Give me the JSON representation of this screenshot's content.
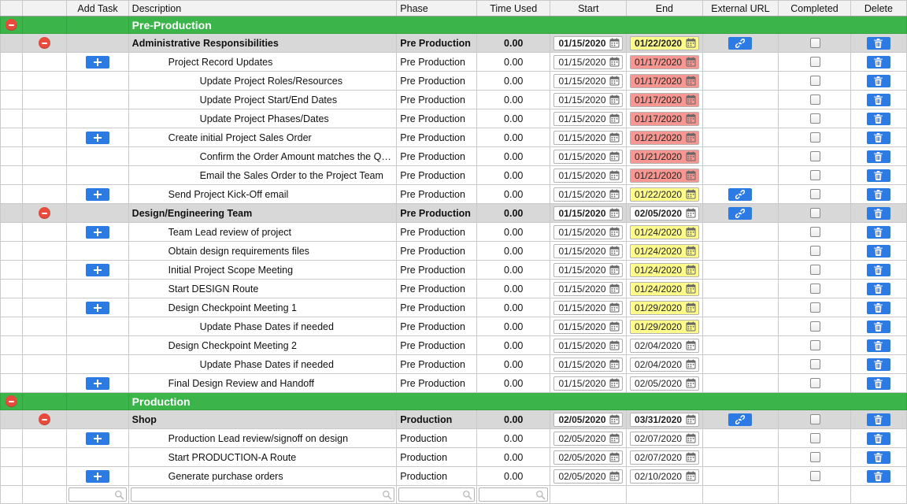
{
  "headers": {
    "c1": "",
    "c2": "",
    "c3": "Add Task",
    "c4": "Description",
    "c5": "Phase",
    "c6": "Time Used",
    "c7": "Start",
    "c8": "End",
    "c9": "External URL",
    "c10": "Completed",
    "c11": "Delete"
  },
  "phases": {
    "pre": "Pre Production",
    "prod": "Production"
  },
  "sections": [
    {
      "title": "Pre-Production",
      "groups": [
        {
          "title": "Administrative Responsibilities",
          "phase": "pre",
          "time": "0.00",
          "start": "01/15/2020",
          "end": "01/22/2020",
          "endClass": "yellow",
          "url": true,
          "rows": [
            {
              "add": true,
              "desc": "Project Record Updates",
              "ind": 1,
              "phase": "pre",
              "time": "0.00",
              "start": "01/15/2020",
              "end": "01/17/2020",
              "endClass": "red"
            },
            {
              "desc": "Update Project Roles/Resources",
              "ind": 2,
              "phase": "pre",
              "time": "0.00",
              "start": "01/15/2020",
              "end": "01/17/2020",
              "endClass": "red"
            },
            {
              "desc": "Update Project Start/End Dates",
              "ind": 2,
              "phase": "pre",
              "time": "0.00",
              "start": "01/15/2020",
              "end": "01/17/2020",
              "endClass": "red"
            },
            {
              "desc": "Update Project Phases/Dates",
              "ind": 2,
              "phase": "pre",
              "time": "0.00",
              "start": "01/15/2020",
              "end": "01/17/2020",
              "endClass": "red"
            },
            {
              "add": true,
              "desc": "Create initial Project Sales Order",
              "ind": 1,
              "phase": "pre",
              "time": "0.00",
              "start": "01/15/2020",
              "end": "01/21/2020",
              "endClass": "red"
            },
            {
              "desc": "Confirm the Order Amount matches the Quote",
              "ind": 2,
              "phase": "pre",
              "time": "0.00",
              "start": "01/15/2020",
              "end": "01/21/2020",
              "endClass": "red"
            },
            {
              "desc": "Email the Sales Order to the Project Team",
              "ind": 2,
              "phase": "pre",
              "time": "0.00",
              "start": "01/15/2020",
              "end": "01/21/2020",
              "endClass": "red"
            },
            {
              "add": true,
              "desc": "Send Project Kick-Off email",
              "ind": 1,
              "phase": "pre",
              "time": "0.00",
              "start": "01/15/2020",
              "end": "01/22/2020",
              "endClass": "yellow",
              "url": true
            }
          ]
        },
        {
          "title": "Design/Engineering Team",
          "phase": "pre",
          "time": "0.00",
          "start": "01/15/2020",
          "end": "02/05/2020",
          "endClass": "",
          "url": true,
          "rows": [
            {
              "add": true,
              "desc": "Team Lead review of project",
              "ind": 1,
              "phase": "pre",
              "time": "0.00",
              "start": "01/15/2020",
              "end": "01/24/2020",
              "endClass": "yellow"
            },
            {
              "desc": "Obtain design requirements files",
              "ind": 1,
              "phase": "pre",
              "time": "0.00",
              "start": "01/15/2020",
              "end": "01/24/2020",
              "endClass": "yellow"
            },
            {
              "add": true,
              "desc": "Initial Project Scope Meeting",
              "ind": 1,
              "phase": "pre",
              "time": "0.00",
              "start": "01/15/2020",
              "end": "01/24/2020",
              "endClass": "yellow"
            },
            {
              "desc": "Start DESIGN Route",
              "ind": 1,
              "phase": "pre",
              "time": "0.00",
              "start": "01/15/2020",
              "end": "01/24/2020",
              "endClass": "yellow"
            },
            {
              "add": true,
              "desc": "Design Checkpoint Meeting 1",
              "ind": 1,
              "phase": "pre",
              "time": "0.00",
              "start": "01/15/2020",
              "end": "01/29/2020",
              "endClass": "yellow"
            },
            {
              "desc": "Update Phase Dates if needed",
              "ind": 2,
              "phase": "pre",
              "time": "0.00",
              "start": "01/15/2020",
              "end": "01/29/2020",
              "endClass": "yellow"
            },
            {
              "desc": "Design Checkpoint Meeting 2",
              "ind": 1,
              "phase": "pre",
              "time": "0.00",
              "start": "01/15/2020",
              "end": "02/04/2020",
              "endClass": ""
            },
            {
              "desc": "Update Phase Dates if needed",
              "ind": 2,
              "phase": "pre",
              "time": "0.00",
              "start": "01/15/2020",
              "end": "02/04/2020",
              "endClass": ""
            },
            {
              "add": true,
              "desc": "Final Design Review and Handoff",
              "ind": 1,
              "phase": "pre",
              "time": "0.00",
              "start": "01/15/2020",
              "end": "02/05/2020",
              "endClass": ""
            }
          ]
        }
      ]
    },
    {
      "title": "Production",
      "groups": [
        {
          "title": "Shop",
          "phase": "prod",
          "time": "0.00",
          "start": "02/05/2020",
          "end": "03/31/2020",
          "endClass": "",
          "url": true,
          "rows": [
            {
              "add": true,
              "desc": "Production Lead review/signoff on design",
              "ind": 1,
              "phase": "prod",
              "time": "0.00",
              "start": "02/05/2020",
              "end": "02/07/2020",
              "endClass": ""
            },
            {
              "desc": "Start PRODUCTION-A Route",
              "ind": 1,
              "phase": "prod",
              "time": "0.00",
              "start": "02/05/2020",
              "end": "02/07/2020",
              "endClass": ""
            },
            {
              "add": true,
              "desc": "Generate purchase orders",
              "ind": 1,
              "phase": "prod",
              "time": "0.00",
              "start": "02/05/2020",
              "end": "02/10/2020",
              "endClass": ""
            }
          ]
        }
      ]
    }
  ]
}
